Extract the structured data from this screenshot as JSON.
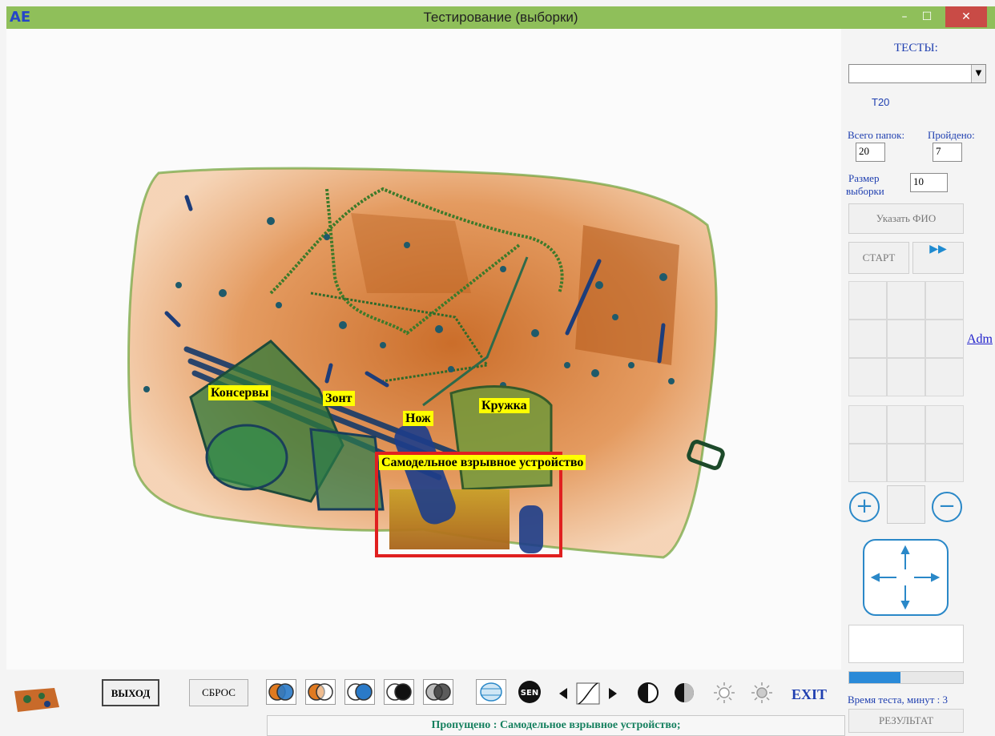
{
  "window": {
    "title": "Тестирование (выборки)",
    "app_icon": "АЕ",
    "minimize": "–",
    "maximize": "☐",
    "close": "✕"
  },
  "labels": {
    "cans": "Консервы",
    "umbrella": "Зонт",
    "knife": "Нож",
    "mug": "Кружка",
    "ied": "Самодельное взрывное устройство"
  },
  "panel": {
    "tests_title": "ТЕСТЫ:",
    "tests_value": "",
    "test_id": "T20",
    "total_folders_label": "Всего папок:",
    "passed_label": "Пройдено:",
    "total_folders_value": "20",
    "passed_value": "7",
    "sample_size_label_1": "Размер",
    "sample_size_label_2": "выборки",
    "sample_size_value": "10",
    "name_button": "Указать ФИО",
    "start_button": "СТАРТ",
    "forward_button": "▶▶",
    "zoom_in": "+",
    "zoom_out": "−",
    "adm_link": "Adm",
    "progress_fraction": 0.45,
    "time_label": "Время теста, минут : 3",
    "result_button": "РЕЗУЛЬТАТ"
  },
  "toolbar": {
    "exit_button": "ВЫХОД",
    "reset_button": "СБРОС",
    "sen_icon_text": "SEN",
    "exit_text": "EXIT"
  },
  "status": {
    "text": "Пропущено : Самодельное взрывное устройство;"
  },
  "colors": {
    "titlebar": "#8fbf5a",
    "orange": "#d2691e",
    "panel_blue": "#1f3fb0",
    "icon_blue": "#2a88c8",
    "highlight": "#ffff00",
    "ied_box": "#e02020"
  }
}
